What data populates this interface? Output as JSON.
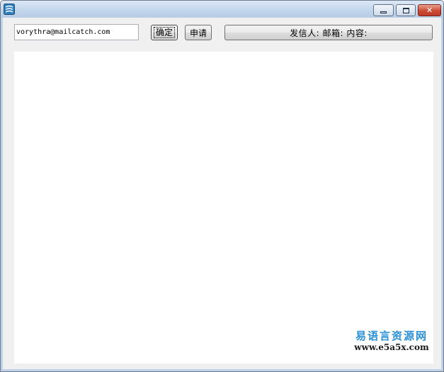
{
  "window": {
    "icon": "app-icon",
    "controls": {
      "minimize_icon": "minimize-icon",
      "maximize_icon": "maximize-icon",
      "close_icon": "close-icon",
      "close_glyph": "✕"
    }
  },
  "toolbar": {
    "email_value": "vorythra@mailcatch.com",
    "confirm_label": "确定",
    "apply_label": "申请",
    "status_label": "发信人:  邮箱:  内容:"
  },
  "content": {
    "text": ""
  },
  "watermark": {
    "cn": "易语言资源网",
    "url": "www.e5a5x.com",
    "color": "#2a8fd6"
  }
}
